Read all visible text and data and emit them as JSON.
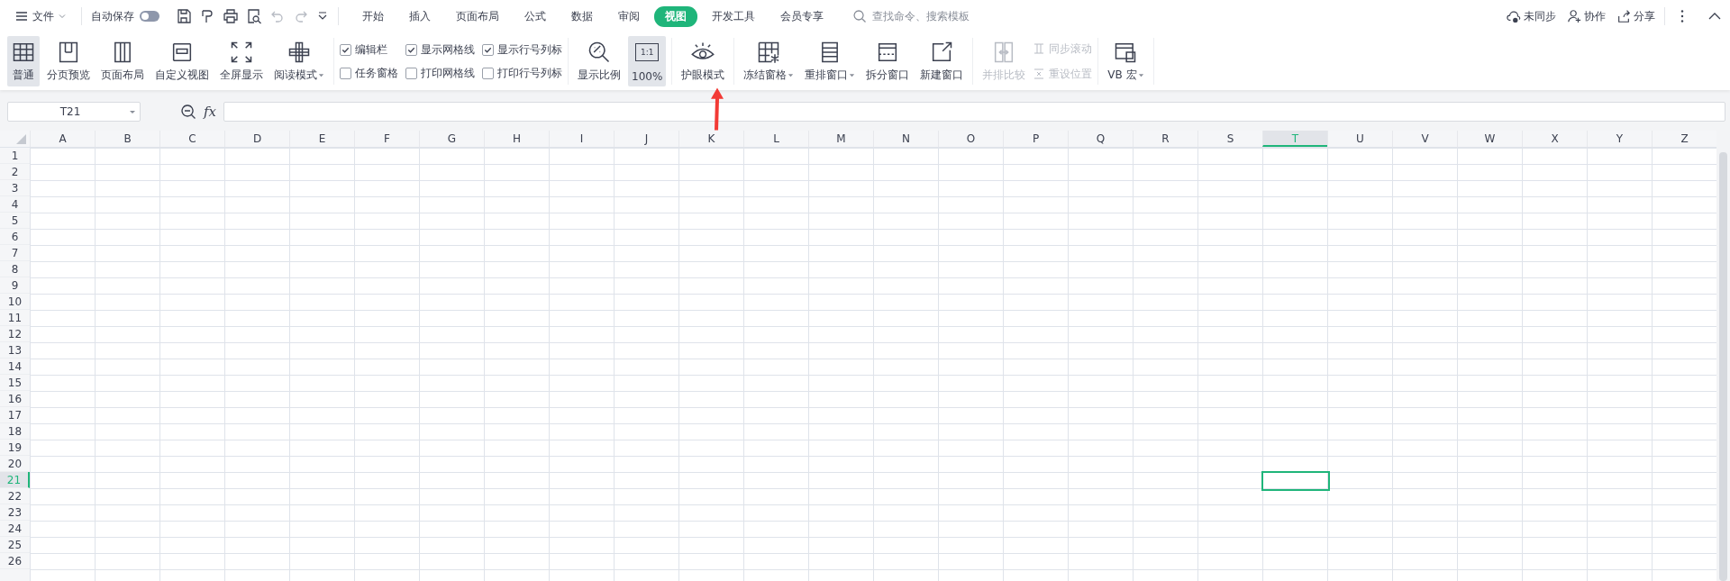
{
  "menu": {
    "label": "文件"
  },
  "autosave": {
    "label": "自动保存",
    "on": false
  },
  "tabs": [
    {
      "label": "开始",
      "selected": false
    },
    {
      "label": "插入",
      "selected": false
    },
    {
      "label": "页面布局",
      "selected": false
    },
    {
      "label": "公式",
      "selected": false
    },
    {
      "label": "数据",
      "selected": false
    },
    {
      "label": "审阅",
      "selected": false
    },
    {
      "label": "视图",
      "selected": true
    },
    {
      "label": "开发工具",
      "selected": false
    },
    {
      "label": "会员专享",
      "selected": false
    }
  ],
  "search": {
    "placeholder": "查找命令、搜索模板"
  },
  "actions": [
    {
      "label": "未同步"
    },
    {
      "label": "协作"
    },
    {
      "label": "分享"
    }
  ],
  "ribbon": [
    {
      "kind": "buttons",
      "items": [
        {
          "label": "普通",
          "selected": true,
          "dropdown": false,
          "disabled": false
        },
        {
          "label": "分页预览",
          "selected": false,
          "dropdown": false,
          "disabled": false
        },
        {
          "label": "页面布局",
          "selected": false,
          "dropdown": false,
          "disabled": false
        },
        {
          "label": "自定义视图",
          "selected": false,
          "dropdown": false,
          "disabled": false
        },
        {
          "label": "全屏显示",
          "selected": false,
          "dropdown": false,
          "disabled": false
        },
        {
          "label": "阅读模式",
          "selected": false,
          "dropdown": true,
          "disabled": false
        }
      ]
    },
    {
      "kind": "checks",
      "items": [
        {
          "label": "编辑栏",
          "checked": true
        },
        {
          "label": "显示网格线",
          "checked": true
        },
        {
          "label": "显示行号列标",
          "checked": true
        },
        {
          "label": "任务窗格",
          "checked": false
        },
        {
          "label": "打印网格线",
          "checked": false
        },
        {
          "label": "打印行号列标",
          "checked": false
        }
      ]
    },
    {
      "kind": "buttons",
      "items": [
        {
          "label": "显示比例",
          "selected": false,
          "dropdown": false,
          "disabled": false
        },
        {
          "label": "100%",
          "icon_text": "1:1",
          "selected": true,
          "dropdown": false,
          "disabled": false
        }
      ]
    },
    {
      "kind": "buttons",
      "items": [
        {
          "label": "护眼模式",
          "selected": false,
          "dropdown": false,
          "disabled": false
        }
      ]
    },
    {
      "kind": "buttons",
      "items": [
        {
          "label": "冻结窗格",
          "selected": false,
          "dropdown": true,
          "disabled": false
        },
        {
          "label": "重排窗口",
          "selected": false,
          "dropdown": true,
          "disabled": false
        },
        {
          "label": "拆分窗口",
          "selected": false,
          "dropdown": false,
          "disabled": false
        },
        {
          "label": "新建窗口",
          "selected": false,
          "dropdown": false,
          "disabled": false
        }
      ]
    },
    {
      "kind": "buttons",
      "items": [
        {
          "label": "并排比较",
          "selected": false,
          "dropdown": false,
          "disabled": true
        }
      ],
      "stack": [
        {
          "label": "同步滚动",
          "disabled": true
        },
        {
          "label": "重设位置",
          "disabled": true
        }
      ]
    },
    {
      "kind": "buttons",
      "items": [
        {
          "label": "VB 宏",
          "selected": false,
          "dropdown": true,
          "disabled": false
        }
      ]
    }
  ],
  "name_box": {
    "value": "T21"
  },
  "formula_bar": {
    "label": "fx"
  },
  "grid": {
    "columns": [
      {
        "label": "A",
        "selected": false
      },
      {
        "label": "B",
        "selected": false
      },
      {
        "label": "C",
        "selected": false
      },
      {
        "label": "D",
        "selected": false
      },
      {
        "label": "E",
        "selected": false
      },
      {
        "label": "F",
        "selected": false
      },
      {
        "label": "G",
        "selected": false
      },
      {
        "label": "H",
        "selected": false
      },
      {
        "label": "I",
        "selected": false
      },
      {
        "label": "J",
        "selected": false
      },
      {
        "label": "K",
        "selected": false
      },
      {
        "label": "L",
        "selected": false
      },
      {
        "label": "M",
        "selected": false
      },
      {
        "label": "N",
        "selected": false
      },
      {
        "label": "O",
        "selected": false
      },
      {
        "label": "P",
        "selected": false
      },
      {
        "label": "Q",
        "selected": false
      },
      {
        "label": "R",
        "selected": false
      },
      {
        "label": "S",
        "selected": false
      },
      {
        "label": "T",
        "selected": true
      },
      {
        "label": "U",
        "selected": false
      },
      {
        "label": "V",
        "selected": false
      },
      {
        "label": "W",
        "selected": false
      },
      {
        "label": "X",
        "selected": false
      },
      {
        "label": "Y",
        "selected": false
      },
      {
        "label": "Z",
        "selected": false
      }
    ],
    "rows": [
      {
        "label": "1",
        "selected": false
      },
      {
        "label": "2",
        "selected": false
      },
      {
        "label": "3",
        "selected": false
      },
      {
        "label": "4",
        "selected": false
      },
      {
        "label": "5",
        "selected": false
      },
      {
        "label": "6",
        "selected": false
      },
      {
        "label": "7",
        "selected": false
      },
      {
        "label": "8",
        "selected": false
      },
      {
        "label": "9",
        "selected": false
      },
      {
        "label": "10",
        "selected": false
      },
      {
        "label": "11",
        "selected": false
      },
      {
        "label": "12",
        "selected": false
      },
      {
        "label": "13",
        "selected": false
      },
      {
        "label": "14",
        "selected": false
      },
      {
        "label": "15",
        "selected": false
      },
      {
        "label": "16",
        "selected": false
      },
      {
        "label": "17",
        "selected": false
      },
      {
        "label": "18",
        "selected": false
      },
      {
        "label": "19",
        "selected": false
      },
      {
        "label": "20",
        "selected": false
      },
      {
        "label": "21",
        "selected": true
      },
      {
        "label": "22",
        "selected": false
      },
      {
        "label": "23",
        "selected": false
      },
      {
        "label": "24",
        "selected": false
      },
      {
        "label": "25",
        "selected": false
      },
      {
        "label": "26",
        "selected": false
      }
    ]
  }
}
